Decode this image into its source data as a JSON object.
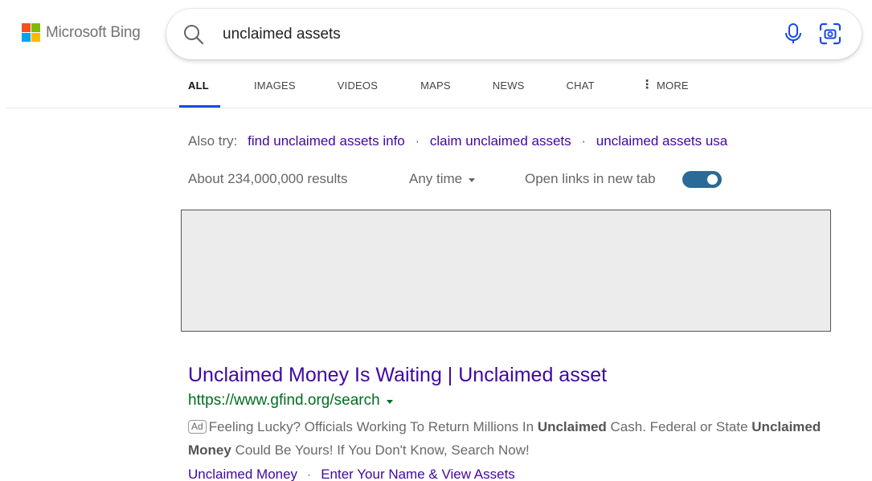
{
  "brand": {
    "name": "Microsoft Bing",
    "colors": {
      "red": "#f25022",
      "green": "#7fba00",
      "blue": "#00a4ef",
      "yellow": "#ffb900"
    }
  },
  "search": {
    "query": "unclaimed assets",
    "placeholder": ""
  },
  "tabs": [
    {
      "label": "ALL",
      "active": true
    },
    {
      "label": "IMAGES",
      "active": false
    },
    {
      "label": "VIDEOS",
      "active": false
    },
    {
      "label": "MAPS",
      "active": false
    },
    {
      "label": "NEWS",
      "active": false
    },
    {
      "label": "CHAT",
      "active": false
    },
    {
      "label": "MORE",
      "active": false
    }
  ],
  "also_try": {
    "label": "Also try:",
    "items": [
      "find unclaimed assets info",
      "claim unclaimed assets",
      "unclaimed assets usa"
    ]
  },
  "results_bar": {
    "count_text": "About 234,000,000 results",
    "time_filter": "Any time",
    "open_links_label": "Open links in new tab",
    "open_links_enabled": true
  },
  "result": {
    "title": "Unclaimed Money Is Waiting | Unclaimed asset",
    "url": "https://www.gfind.org/search",
    "ad_label": "Ad",
    "snippet_parts": [
      "Feeling Lucky? Officials Working To Return Millions In ",
      "Unclaimed",
      " Cash. Federal or State ",
      "Unclaimed Money",
      " Could Be Yours! If You Don't Know, Search Now!"
    ],
    "sitelinks": [
      "Unclaimed Money",
      "Enter Your Name & View Assets"
    ]
  },
  "colors": {
    "link": "#4007a2",
    "url_green": "#006d21",
    "tab_active": "#174ae4",
    "toggle": "#2b6a96",
    "icon_blue": "#174ae4"
  }
}
